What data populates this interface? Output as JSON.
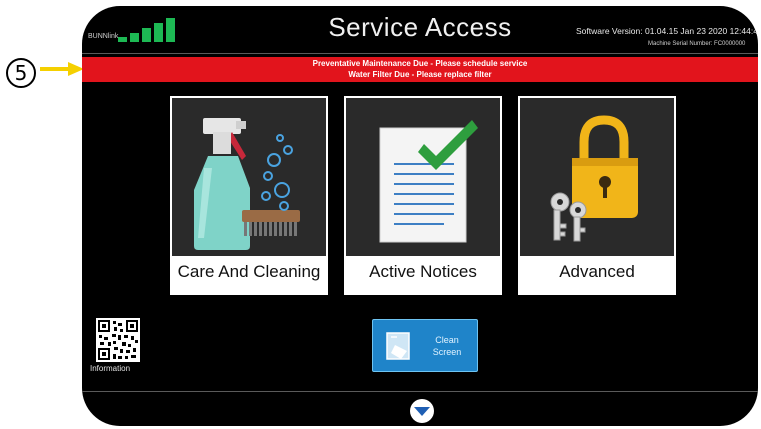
{
  "callout": {
    "number": "5"
  },
  "header": {
    "brand": "BUNNlink",
    "signal_bars": 5,
    "title": "Service Access",
    "software_version": "Software Version: 01.04.15 Jan 23 2020 12:44:40",
    "serial": "Machine Serial Number: FC0000000"
  },
  "alert": {
    "lines": [
      "Preventative Maintenance Due - Please schedule service",
      "Water Filter Due - Please replace filter"
    ]
  },
  "tiles": [
    {
      "label": "Care And Cleaning",
      "icon": "cleaning-spray-icon"
    },
    {
      "label": "Active Notices",
      "icon": "notice-checklist-icon"
    },
    {
      "label": "Advanced",
      "icon": "padlock-keys-icon"
    }
  ],
  "information": {
    "label": "Information",
    "icon": "qr-code-icon"
  },
  "clean_screen": {
    "label_line1": "Clean",
    "label_line2": "Screen",
    "icon": "wipe-screen-icon"
  },
  "nav": {
    "icon": "chevron-down-icon"
  },
  "colors": {
    "alert": "#e2141c",
    "signal": "#1db954",
    "button": "#1f84c9",
    "check": "#2e9e3e",
    "lock": "#f1b519"
  }
}
